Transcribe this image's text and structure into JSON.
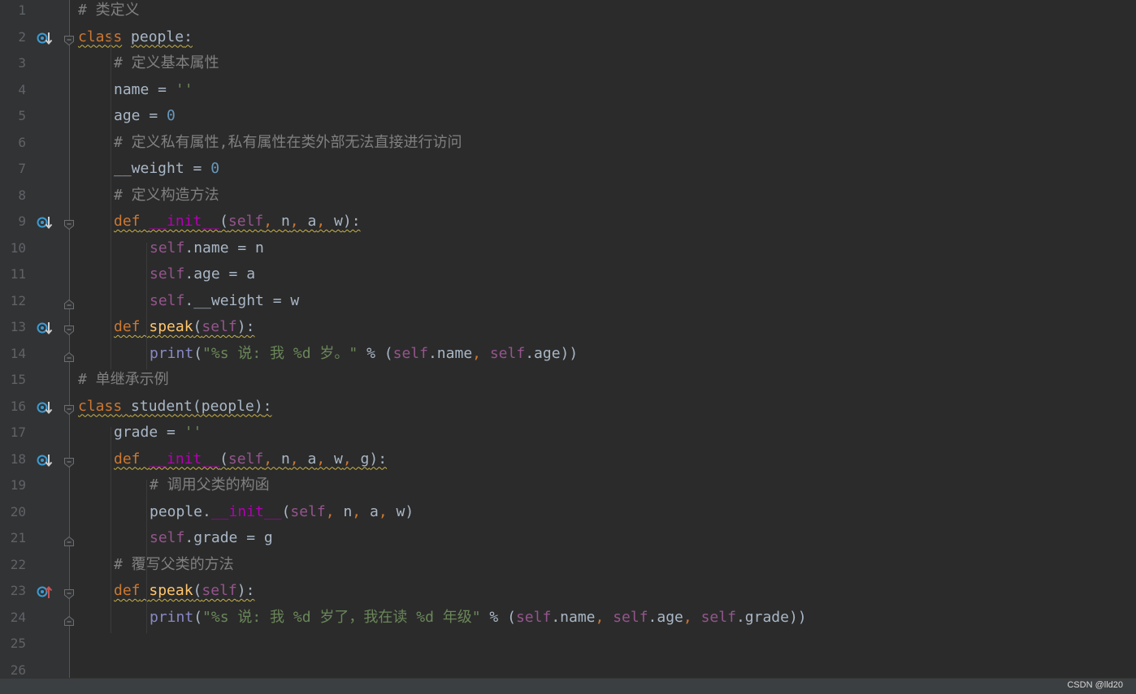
{
  "editor": {
    "lines": [
      {
        "n": "1",
        "indent": 0,
        "marker": null,
        "fold": null,
        "tokens": [
          {
            "t": "# 类定义",
            "c": "cmt"
          }
        ]
      },
      {
        "n": "2",
        "indent": 0,
        "marker": "down",
        "fold": "open",
        "tokens": [
          {
            "t": "class",
            "c": "kw wavy"
          },
          {
            "t": " ",
            "c": "op"
          },
          {
            "t": "people",
            "c": "cls"
          },
          {
            "t": ":",
            "c": "op wavy"
          }
        ]
      },
      {
        "n": "3",
        "indent": 1,
        "marker": null,
        "fold": null,
        "tokens": [
          {
            "t": "# 定义基本属性",
            "c": "cmt"
          }
        ]
      },
      {
        "n": "4",
        "indent": 1,
        "marker": null,
        "fold": null,
        "tokens": [
          {
            "t": "name = ",
            "c": "op"
          },
          {
            "t": "''",
            "c": "str"
          }
        ]
      },
      {
        "n": "5",
        "indent": 1,
        "marker": null,
        "fold": null,
        "tokens": [
          {
            "t": "age = ",
            "c": "op"
          },
          {
            "t": "0",
            "c": "num"
          }
        ]
      },
      {
        "n": "6",
        "indent": 1,
        "marker": null,
        "fold": null,
        "tokens": [
          {
            "t": "# 定义私有属性,私有属性在类外部无法直接进行访问",
            "c": "cmt"
          }
        ]
      },
      {
        "n": "7",
        "indent": 1,
        "marker": null,
        "fold": null,
        "tokens": [
          {
            "t": "__weight = ",
            "c": "op"
          },
          {
            "t": "0",
            "c": "num"
          }
        ]
      },
      {
        "n": "8",
        "indent": 1,
        "marker": null,
        "fold": null,
        "tokens": [
          {
            "t": "# 定义构造方法",
            "c": "cmt"
          }
        ]
      },
      {
        "n": "9",
        "indent": 1,
        "marker": "down",
        "fold": "open",
        "tokens": [
          {
            "t": "def",
            "c": "kw wavy"
          },
          {
            "t": " ",
            "c": "op wavy"
          },
          {
            "t": "__init__",
            "c": "dd wavy"
          },
          {
            "t": "(",
            "c": "op wavy"
          },
          {
            "t": "self",
            "c": "slf wavy"
          },
          {
            "t": ", ",
            "c": "sep wavy"
          },
          {
            "t": "n",
            "c": "op wavy"
          },
          {
            "t": ", ",
            "c": "sep wavy"
          },
          {
            "t": "a",
            "c": "op wavy"
          },
          {
            "t": ", ",
            "c": "sep wavy"
          },
          {
            "t": "w",
            "c": "op wavy"
          },
          {
            "t": "):",
            "c": "op wavy"
          }
        ]
      },
      {
        "n": "10",
        "indent": 2,
        "marker": null,
        "fold": null,
        "tokens": [
          {
            "t": "self",
            "c": "slf"
          },
          {
            "t": ".name = n",
            "c": "op"
          }
        ]
      },
      {
        "n": "11",
        "indent": 2,
        "marker": null,
        "fold": null,
        "tokens": [
          {
            "t": "self",
            "c": "slf"
          },
          {
            "t": ".age = a",
            "c": "op"
          }
        ]
      },
      {
        "n": "12",
        "indent": 2,
        "marker": null,
        "fold": "end",
        "tokens": [
          {
            "t": "self",
            "c": "slf"
          },
          {
            "t": ".__weight = w",
            "c": "op"
          }
        ]
      },
      {
        "n": "13",
        "indent": 1,
        "marker": "down",
        "fold": "open",
        "tokens": [
          {
            "t": "def",
            "c": "kw wavy"
          },
          {
            "t": " ",
            "c": "op wavy"
          },
          {
            "t": "speak",
            "c": "fn wavy"
          },
          {
            "t": "(",
            "c": "op wavy"
          },
          {
            "t": "self",
            "c": "slf wavy"
          },
          {
            "t": "):",
            "c": "op wavy"
          }
        ]
      },
      {
        "n": "14",
        "indent": 2,
        "marker": null,
        "fold": "end",
        "tokens": [
          {
            "t": "print",
            "c": "bi"
          },
          {
            "t": "(",
            "c": "op"
          },
          {
            "t": "\"%s 说: 我 %d 岁。\"",
            "c": "str"
          },
          {
            "t": " % (",
            "c": "op"
          },
          {
            "t": "self",
            "c": "slf"
          },
          {
            "t": ".name",
            "c": "op"
          },
          {
            "t": ", ",
            "c": "sep"
          },
          {
            "t": "self",
            "c": "slf"
          },
          {
            "t": ".age))",
            "c": "op"
          }
        ]
      },
      {
        "n": "15",
        "indent": 0,
        "marker": null,
        "fold": null,
        "tokens": [
          {
            "t": "# 单继承示例",
            "c": "cmt"
          }
        ]
      },
      {
        "n": "16",
        "indent": 0,
        "marker": "down",
        "fold": "open",
        "tokens": [
          {
            "t": "class",
            "c": "kw wavy"
          },
          {
            "t": " ",
            "c": "op wavy"
          },
          {
            "t": "student(people)",
            "c": "op wavy"
          },
          {
            "t": ":",
            "c": "op wavy"
          }
        ]
      },
      {
        "n": "17",
        "indent": 1,
        "marker": null,
        "fold": null,
        "tokens": [
          {
            "t": "grade = ",
            "c": "op"
          },
          {
            "t": "''",
            "c": "str"
          }
        ]
      },
      {
        "n": "18",
        "indent": 1,
        "marker": "down",
        "fold": "open",
        "tokens": [
          {
            "t": "def",
            "c": "kw wavy"
          },
          {
            "t": " ",
            "c": "op wavy"
          },
          {
            "t": "__init__",
            "c": "dd wavy"
          },
          {
            "t": "(",
            "c": "op wavy"
          },
          {
            "t": "self",
            "c": "slf wavy"
          },
          {
            "t": ", ",
            "c": "sep wavy"
          },
          {
            "t": "n",
            "c": "op wavy"
          },
          {
            "t": ", ",
            "c": "sep wavy"
          },
          {
            "t": "a",
            "c": "op wavy"
          },
          {
            "t": ", ",
            "c": "sep wavy"
          },
          {
            "t": "w",
            "c": "op wavy"
          },
          {
            "t": ", ",
            "c": "sep wavy"
          },
          {
            "t": "g",
            "c": "op wavy"
          },
          {
            "t": "):",
            "c": "op wavy"
          }
        ]
      },
      {
        "n": "19",
        "indent": 2,
        "marker": null,
        "fold": null,
        "tokens": [
          {
            "t": "# 调用父类的构函",
            "c": "cmt"
          }
        ]
      },
      {
        "n": "20",
        "indent": 2,
        "marker": null,
        "fold": null,
        "tokens": [
          {
            "t": "people.",
            "c": "op"
          },
          {
            "t": "__init__",
            "c": "dd"
          },
          {
            "t": "(",
            "c": "op"
          },
          {
            "t": "self",
            "c": "slf"
          },
          {
            "t": ", ",
            "c": "sep"
          },
          {
            "t": "n",
            "c": "op"
          },
          {
            "t": ", ",
            "c": "sep"
          },
          {
            "t": "a",
            "c": "op"
          },
          {
            "t": ", ",
            "c": "sep"
          },
          {
            "t": "w)",
            "c": "op"
          }
        ]
      },
      {
        "n": "21",
        "indent": 2,
        "marker": null,
        "fold": "end",
        "tokens": [
          {
            "t": "self",
            "c": "slf"
          },
          {
            "t": ".grade = g",
            "c": "op"
          }
        ]
      },
      {
        "n": "22",
        "indent": 1,
        "marker": null,
        "fold": null,
        "tokens": [
          {
            "t": "# 覆写父类的方法",
            "c": "cmt"
          }
        ]
      },
      {
        "n": "23",
        "indent": 1,
        "marker": "up",
        "fold": "open",
        "tokens": [
          {
            "t": "def",
            "c": "kw wavy"
          },
          {
            "t": " ",
            "c": "op wavy"
          },
          {
            "t": "speak",
            "c": "fn wavy"
          },
          {
            "t": "(",
            "c": "op wavy"
          },
          {
            "t": "self",
            "c": "slf wavy"
          },
          {
            "t": "):",
            "c": "op wavy"
          }
        ]
      },
      {
        "n": "24",
        "indent": 2,
        "marker": null,
        "fold": "end",
        "tokens": [
          {
            "t": "print",
            "c": "bi"
          },
          {
            "t": "(",
            "c": "op"
          },
          {
            "t": "\"%s 说: 我 %d 岁了，我在读 %d 年级\"",
            "c": "str"
          },
          {
            "t": " % (",
            "c": "op"
          },
          {
            "t": "self",
            "c": "slf"
          },
          {
            "t": ".name",
            "c": "op"
          },
          {
            "t": ", ",
            "c": "sep"
          },
          {
            "t": "self",
            "c": "slf"
          },
          {
            "t": ".age",
            "c": "op"
          },
          {
            "t": ", ",
            "c": "sep"
          },
          {
            "t": "self",
            "c": "slf"
          },
          {
            "t": ".grade))",
            "c": "op"
          }
        ]
      },
      {
        "n": "25",
        "indent": 0,
        "marker": null,
        "fold": null,
        "tokens": []
      },
      {
        "n": "26",
        "indent": 0,
        "marker": null,
        "fold": null,
        "tokens": []
      }
    ]
  },
  "watermark": "CSDN @lld20",
  "colors": {
    "background": "#2b2b2b",
    "gutter": "#313335",
    "keyword": "#cc7832",
    "function": "#ffc66d",
    "dunder": "#b200b2",
    "self": "#94558d",
    "number": "#6897bb",
    "string": "#6a8759",
    "comment": "#808080",
    "builtin": "#8888c6",
    "override_marker": "#3d9bd1",
    "overriding_marker": "#c75450"
  }
}
